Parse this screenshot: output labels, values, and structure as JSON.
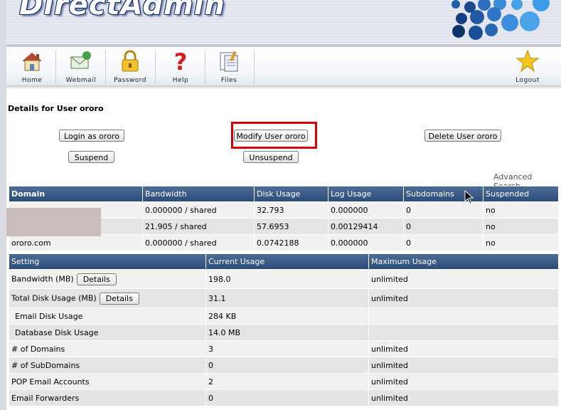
{
  "app": {
    "logo_text": "DirectAdmin"
  },
  "toolbar": {
    "items": [
      {
        "label": "Home",
        "icon": "house-icon"
      },
      {
        "label": "Webmail",
        "icon": "mail-icon"
      },
      {
        "label": "Password",
        "icon": "padlock-icon"
      },
      {
        "label": "Help",
        "icon": "question-mark-icon"
      },
      {
        "label": "Files",
        "icon": "files-icon"
      }
    ],
    "logout": {
      "label": "Logout",
      "icon": "star-icon"
    }
  },
  "page": {
    "title": "Details for User ororo",
    "buttons": {
      "login_as": "Login as ororo",
      "modify": "Modify User ororo",
      "delete": "Delete User ororo",
      "suspend": "Suspend",
      "unsuspend": "Unsuspend"
    },
    "advanced_search": "Advanced Search"
  },
  "domains_table": {
    "headers": [
      "Domain",
      "Bandwidth",
      "Disk Usage",
      "Log Usage",
      "Subdomains",
      "Suspended"
    ],
    "rows": [
      {
        "domain": "",
        "bandwidth": "0.000000 / shared",
        "disk": "32.793",
        "log": "0.000000",
        "subdomains": "0",
        "suspended": "no"
      },
      {
        "domain": "",
        "bandwidth": "21.905 / shared",
        "disk": "57.6953",
        "log": "0.00129414",
        "subdomains": "0",
        "suspended": "no"
      },
      {
        "domain": "ororo.com",
        "bandwidth": "0.000000 / shared",
        "disk": "0.0742188",
        "log": "0.000000",
        "subdomains": "0",
        "suspended": "no"
      }
    ]
  },
  "usage_table": {
    "headers": [
      "Setting",
      "Current Usage",
      "Maximum Usage"
    ],
    "details_label": "Details",
    "rows": [
      {
        "setting": "Bandwidth (MB)",
        "current": "198.0",
        "max": "unlimited"
      },
      {
        "setting": "Total Disk Usage (MB)",
        "current": "31.1",
        "max": "unlimited"
      },
      {
        "setting": "Email Disk Usage",
        "current": "284 KB",
        "max": ""
      },
      {
        "setting": "Database Disk Usage",
        "current": "14.0 MB",
        "max": ""
      },
      {
        "setting": "# of Domains",
        "current": "3",
        "max": "unlimited"
      },
      {
        "setting": "# of SubDomains",
        "current": "0",
        "max": "unlimited"
      },
      {
        "setting": "POP Email Accounts",
        "current": "2",
        "max": "unlimited"
      },
      {
        "setting": "Email Forwarders",
        "current": "0",
        "max": "unlimited"
      }
    ]
  },
  "colors": {
    "header_blue": "#294b78",
    "highlight_red": "#d9000d"
  }
}
